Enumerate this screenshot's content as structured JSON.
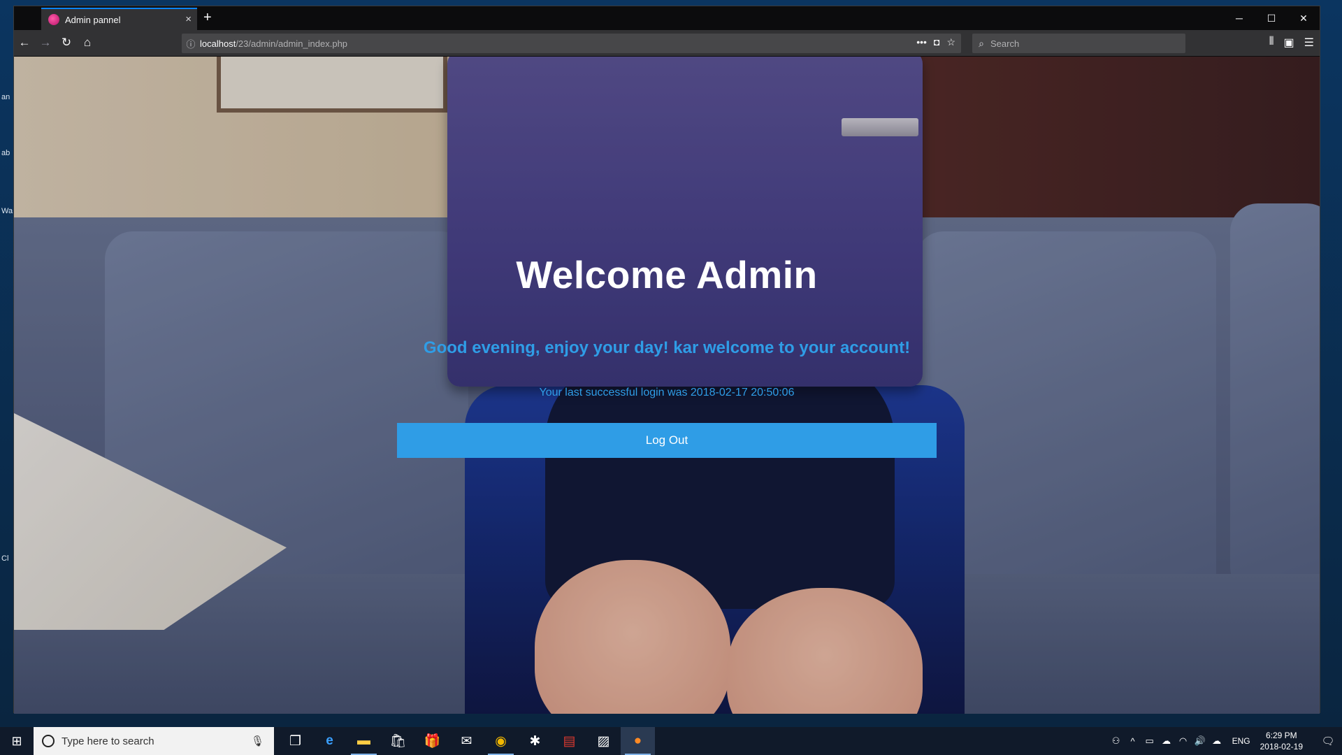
{
  "desktop": {
    "snippets": [
      "an",
      "ab",
      "Wa",
      "Cl"
    ]
  },
  "browser": {
    "tab": {
      "title": "Admin pannel",
      "close_label": "×"
    },
    "new_tab_label": "+",
    "window_controls": {
      "minimize": "─",
      "maximize": "☐",
      "close": "✕"
    },
    "nav": {
      "back": "←",
      "forward": "→",
      "reload": "↻",
      "home": "⌂"
    },
    "url": {
      "host": "localhost",
      "path": "/23/admin/admin_index.php"
    },
    "search": {
      "placeholder": "Search"
    }
  },
  "page": {
    "title": "Welcome Admin",
    "greeting": "Good evening, enjoy your day! kar welcome to your account!",
    "last_login": "Your last successful login was 2018-02-17 20:50:06",
    "logout_label": "Log Out"
  },
  "taskbar": {
    "search_placeholder": "Type here to search",
    "apps": [
      "task-view",
      "edge",
      "file-explorer",
      "store",
      "gift",
      "mail",
      "chrome",
      "slack",
      "acrobat",
      "photos",
      "firefox"
    ],
    "language": "ENG",
    "time": "6:29 PM",
    "date": "2018-02-19"
  },
  "colors": {
    "accent": "#2f9de6",
    "title_text": "#ffffff"
  }
}
